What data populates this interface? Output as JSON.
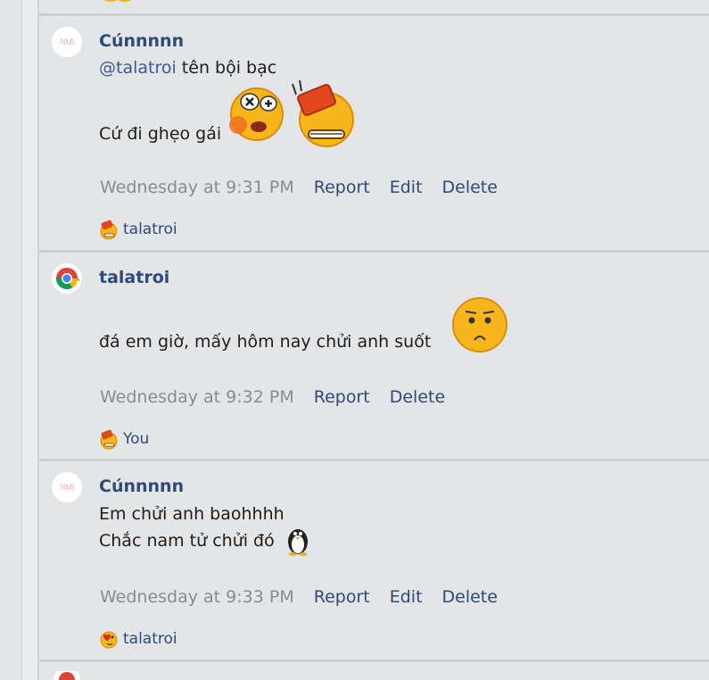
{
  "posts": [
    {
      "username": "Cúnnnnn",
      "avatar_text": "NMI",
      "lines": [
        {
          "mention": "@talatroi",
          "text": " tên bội bạc"
        },
        {
          "mention": "",
          "text": "Cứ đi ghẹo gái"
        }
      ],
      "timestamp": "Wednesday at 9:31 PM",
      "actions": [
        "Report",
        "Edit",
        "Delete"
      ],
      "reaction_user": "talatroi",
      "reaction_icon": "angry-reaction-icon"
    },
    {
      "username": "talatroi",
      "avatar_text": "",
      "lines": [
        {
          "mention": "",
          "text": "đá em giờ, mấy hôm nay chửi anh suốt"
        }
      ],
      "timestamp": "Wednesday at 9:32 PM",
      "actions": [
        "Report",
        "Delete"
      ],
      "reaction_user": "You",
      "reaction_icon": "angry-reaction-icon"
    },
    {
      "username": "Cúnnnnn",
      "avatar_text": "NMI",
      "lines": [
        {
          "mention": "",
          "text": "Em chửi anh baohhhh"
        },
        {
          "mention": "",
          "text": "Chắc nam tử chửi đó"
        }
      ],
      "timestamp": "Wednesday at 9:33 PM",
      "actions": [
        "Report",
        "Edit",
        "Delete"
      ],
      "reaction_user": "talatroi",
      "reaction_icon": "love-reaction-icon"
    }
  ],
  "colors": {
    "username": "#2d4a7a",
    "timestamp": "#8a8b8d",
    "action": "#2d4a7a",
    "background": "#e4e5e7",
    "separator": "#cdced0"
  }
}
